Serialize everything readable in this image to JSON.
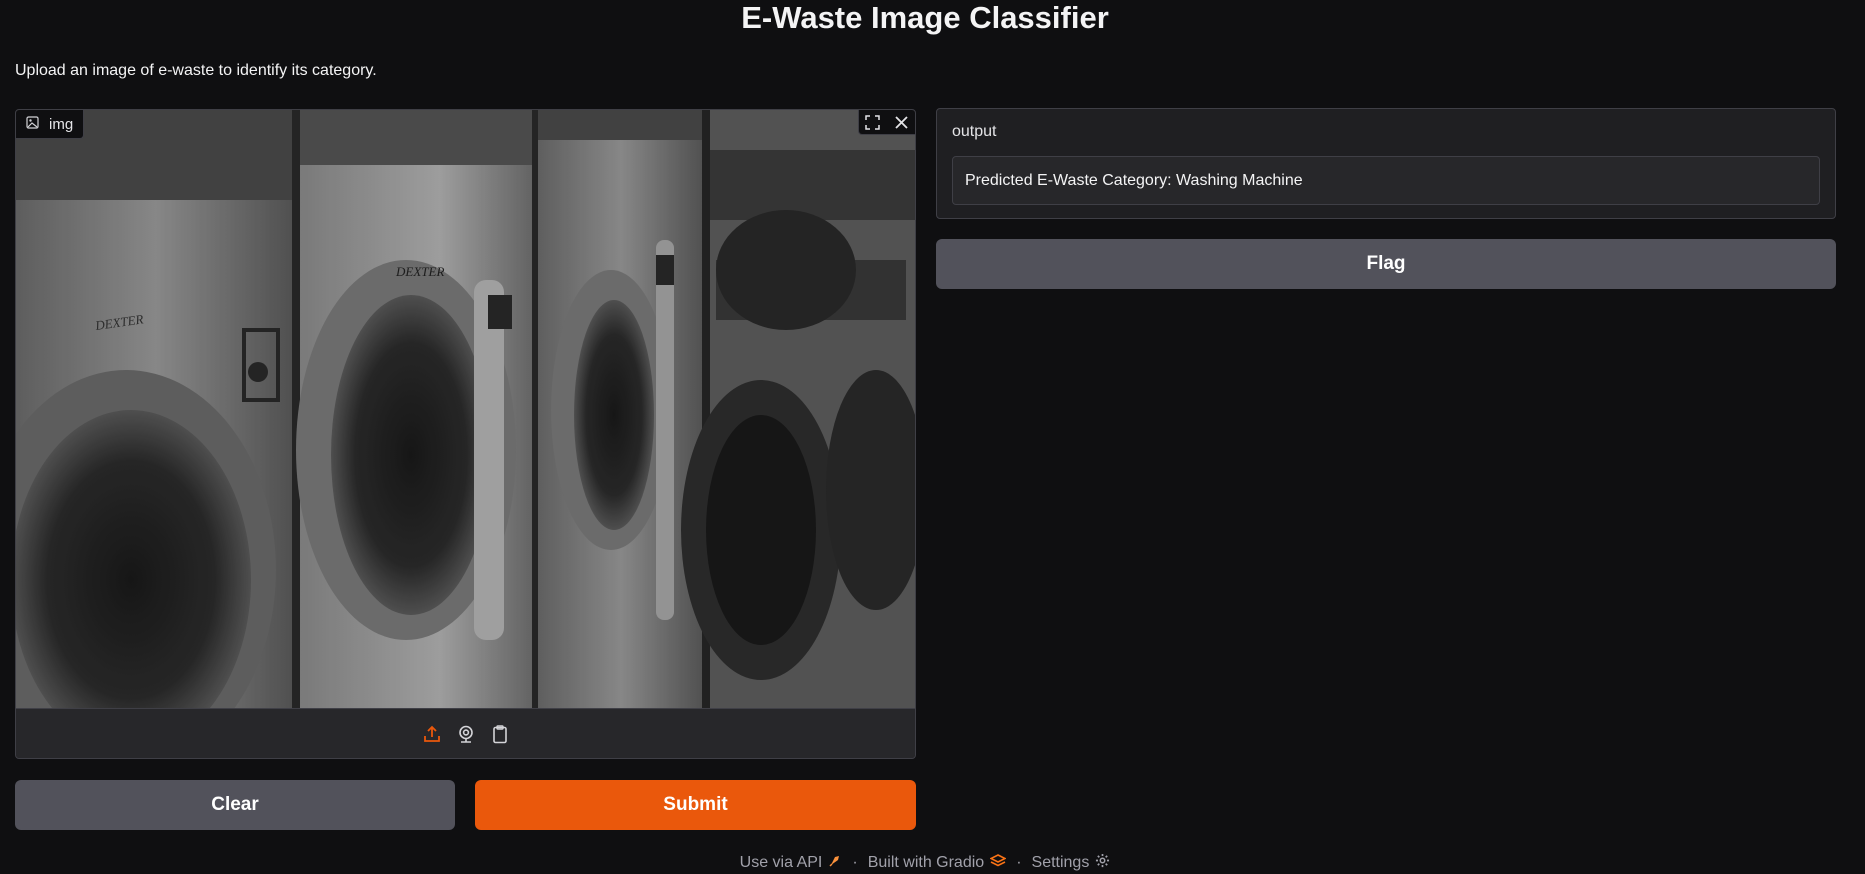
{
  "header": {
    "title": "E-Waste Image Classifier",
    "description": "Upload an image of e-waste to identify its category."
  },
  "image_input": {
    "label": "img",
    "image_subject": "black-and-white photo of a row of front-loading laundromat washing machines",
    "tools": [
      "fullscreen-icon",
      "close-icon"
    ],
    "sources": [
      "upload-icon",
      "webcam-icon",
      "clipboard-icon"
    ],
    "machine_brand_text": "DEXTER"
  },
  "buttons": {
    "clear": "Clear",
    "submit": "Submit",
    "flag": "Flag"
  },
  "output": {
    "label": "output",
    "value": "Predicted E-Waste Category: Washing Machine"
  },
  "footer": {
    "api": "Use via API",
    "built": "Built with Gradio",
    "settings": "Settings",
    "separator": "·"
  },
  "colors": {
    "background": "#0f0f11",
    "accent": "#ea580c",
    "secondary_button": "#52525b",
    "panel": "#27272a",
    "border": "#3f3f46"
  }
}
